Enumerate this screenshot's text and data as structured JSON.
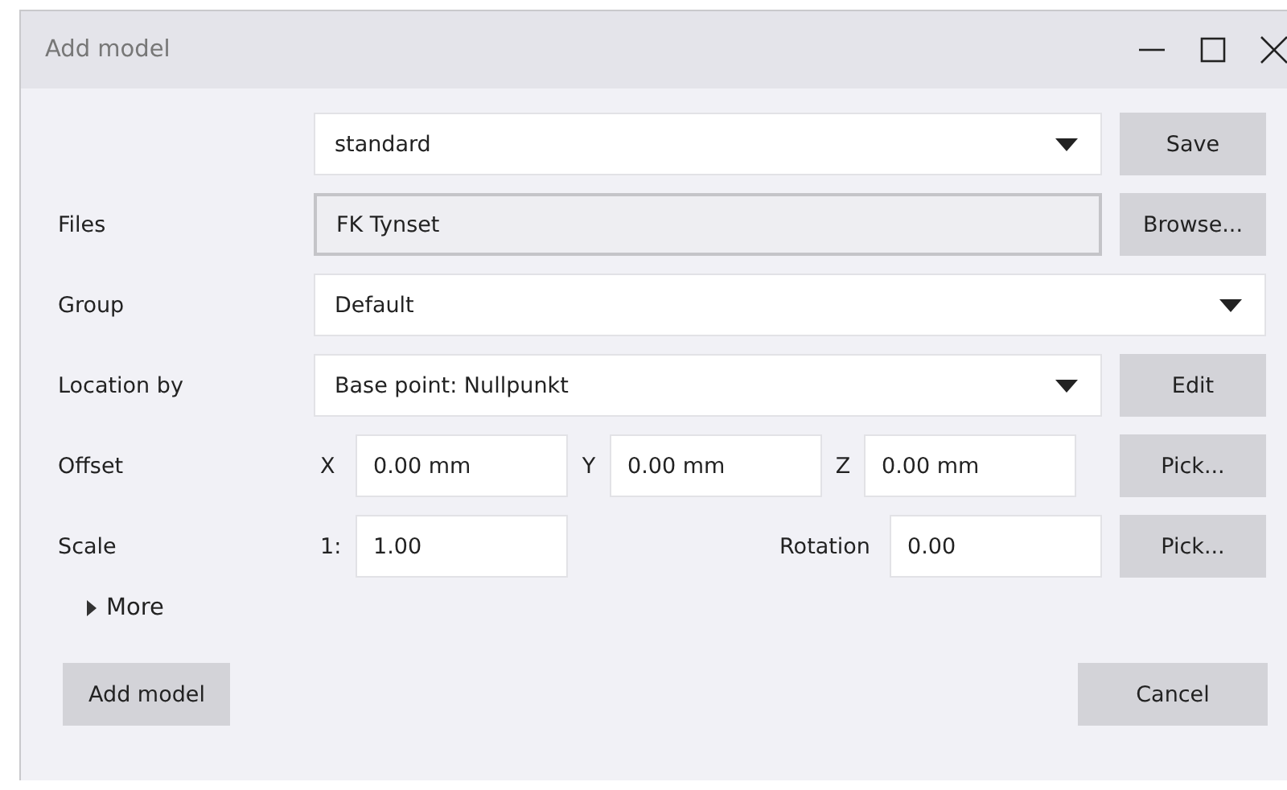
{
  "window": {
    "title": "Add model"
  },
  "rows": [
    {
      "kind": "dropdown",
      "value": "standard",
      "button": "Save"
    },
    {
      "kind": "file",
      "label": "Files",
      "value": "FK Tynset",
      "button": "Browse..."
    },
    {
      "kind": "dropdown",
      "label": "Group",
      "value": "Default"
    },
    {
      "kind": "dropdown",
      "label": "Location by",
      "value": "Base point: Nullpunkt",
      "button": "Edit"
    },
    {
      "kind": "xyz",
      "label": "Offset",
      "fields": [
        {
          "prefix": "X",
          "value": "0.00 mm"
        },
        {
          "prefix": "Y",
          "value": "0.00 mm"
        },
        {
          "prefix": "Z",
          "value": "0.00 mm"
        }
      ],
      "button": "Pick..."
    },
    {
      "kind": "scale",
      "label": "Scale",
      "prefix": "1:",
      "value": "1.00",
      "rotation_label": "Rotation",
      "rotation": "0.00",
      "button": "Pick..."
    }
  ],
  "more": {
    "label": "More",
    "expanded": false
  },
  "footer": {
    "ok": "Add model",
    "cancel": "Cancel"
  }
}
